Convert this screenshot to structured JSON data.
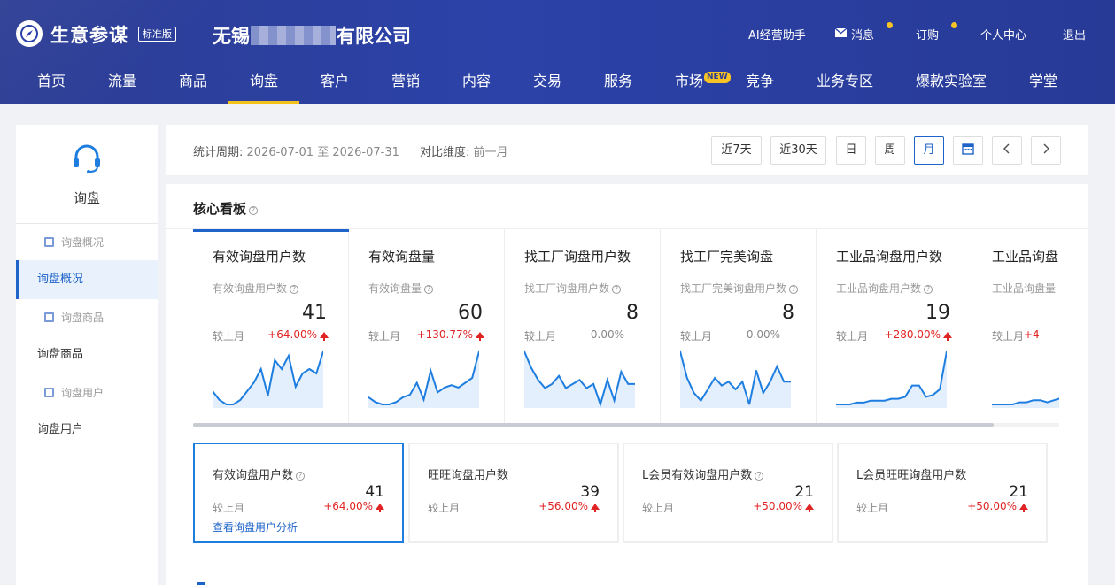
{
  "header": {
    "app_name": "生意参谋",
    "edition": "标准版",
    "company_prefix": "无锡",
    "company_suffix": "有限公司",
    "top_links": {
      "ai": "AI经营助手",
      "messages": "消息",
      "subscribe": "订购",
      "profile": "个人中心",
      "logout": "退出"
    },
    "notification_color": "#f7c325"
  },
  "main_nav": {
    "items": [
      "首页",
      "流量",
      "商品",
      "询盘",
      "客户",
      "营销",
      "内容",
      "交易",
      "服务",
      "市场",
      "竞争",
      "业务专区",
      "爆款实验室",
      "学堂"
    ],
    "active": "询盘",
    "new_badge": "NEW"
  },
  "sidebar": {
    "title": "询盘",
    "items": [
      {
        "label": "询盘概况",
        "type": "sub"
      },
      {
        "label": "询盘概况",
        "type": "main",
        "active": true
      },
      {
        "label": "询盘商品",
        "type": "sub"
      },
      {
        "label": "询盘商品",
        "type": "main"
      },
      {
        "label": "询盘用户",
        "type": "sub"
      },
      {
        "label": "询盘用户",
        "type": "main"
      }
    ]
  },
  "period": {
    "label": "统计周期:",
    "value": "2026-07-01 至 2026-07-31",
    "compare_label": "对比维度:",
    "compare_value": "前一月",
    "buttons": [
      "近7天",
      "近30天",
      "日",
      "周",
      "月"
    ],
    "selected": "月"
  },
  "core_panel": {
    "title": "核心看板",
    "cards": [
      {
        "title": "有效询盘用户数",
        "sub": "有效询盘用户数",
        "value": "41",
        "compare": "较上月",
        "change": "+64.00%",
        "trend": "up",
        "spark": [
          5,
          3,
          2,
          2,
          3,
          5,
          7,
          10,
          4,
          12,
          10,
          13,
          6,
          9,
          10,
          9,
          14
        ]
      },
      {
        "title": "有效询盘量",
        "sub": "有效询盘量",
        "value": "60",
        "compare": "较上月",
        "change": "+130.77%",
        "trend": "up",
        "spark": [
          5,
          3,
          2,
          2,
          3,
          5,
          6,
          11,
          4,
          16,
          7,
          9,
          10,
          9,
          11,
          13,
          24
        ]
      },
      {
        "title": "找工厂询盘用户数",
        "sub": "找工厂询盘用户数",
        "value": "8",
        "compare": "较上月",
        "change": "0.00%",
        "trend": "flat",
        "spark": [
          14,
          10,
          7,
          5,
          6,
          8,
          5,
          6,
          7,
          5,
          6,
          1,
          7,
          2,
          9,
          6,
          6
        ]
      },
      {
        "title": "找工厂完美询盘",
        "sub": "找工厂完美询盘用户数",
        "value": "8",
        "compare": "较上月",
        "change": "0.00%",
        "trend": "flat",
        "spark": [
          14,
          7,
          3,
          1,
          4,
          7,
          5,
          6,
          4,
          6,
          0,
          9,
          3,
          6,
          10,
          6,
          6
        ]
      },
      {
        "title": "工业品询盘用户数",
        "sub": "工业品询盘用户数",
        "value": "19",
        "compare": "较上月",
        "change": "+280.00%",
        "trend": "up",
        "spark": [
          0,
          0,
          0,
          1,
          1,
          2,
          2,
          2,
          3,
          3,
          4,
          10,
          10,
          4,
          5,
          8,
          28
        ]
      },
      {
        "title": "工业品询盘",
        "sub": "工业品询盘量",
        "value": "",
        "compare": "较上月",
        "change": "+4",
        "trend": "up",
        "spark": [
          0,
          0,
          0,
          0,
          1,
          1,
          2,
          2,
          1,
          2,
          3,
          6,
          14,
          14,
          16,
          18,
          25
        ]
      }
    ],
    "mini_cards": [
      {
        "title": "有效询盘用户数",
        "value": "41",
        "compare": "较上月",
        "change": "+64.00%",
        "link": "查看询盘用户分析",
        "active": true
      },
      {
        "title": "旺旺询盘用户数",
        "value": "39",
        "compare": "较上月",
        "change": "+56.00%"
      },
      {
        "title": "L会员有效询盘用户数",
        "value": "21",
        "compare": "较上月",
        "change": "+50.00%"
      },
      {
        "title": "L会员旺旺询盘用户数",
        "value": "21",
        "compare": "较上月",
        "change": "+50.00%"
      }
    ]
  },
  "colors": {
    "accent": "#1e63c9",
    "up": "#e02424",
    "spark_line": "#1e7ee0",
    "spark_fill": "#e3effc"
  }
}
